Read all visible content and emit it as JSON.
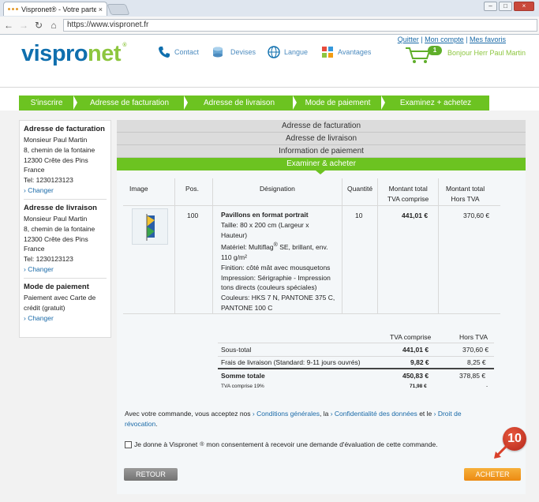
{
  "browser": {
    "tab_title": "Vispronet® - Votre parten",
    "tab_close": "×",
    "url": "https://www.vispronet.fr",
    "window_buttons": [
      "–",
      "□",
      "×"
    ]
  },
  "header": {
    "logo_a": "vispro",
    "logo_b": "net",
    "logo_reg": "®",
    "nav": [
      {
        "label": "Contact",
        "icon": "phone-icon"
      },
      {
        "label": "Devises",
        "icon": "coins-icon"
      },
      {
        "label": "Langue",
        "icon": "globe-icon"
      },
      {
        "label": "Avantages",
        "icon": "puzzle-icon"
      }
    ],
    "top_links": [
      "Quitter",
      "Mon compte",
      "Mes favoris"
    ],
    "cart_count": "1",
    "greeting": "Bonjour Herr Paul Martin"
  },
  "steps": [
    "S'inscrire",
    "Adresse de facturation",
    "Adresse de livraison",
    "Mode de paiement",
    "Examinez + achetez"
  ],
  "sidebar": {
    "billing": {
      "title": "Adresse de facturation",
      "lines": [
        "Monsieur Paul Martin",
        "8, chemin de la fontaine",
        "12300 Crête des Pins",
        "France",
        "Tel: 1230123123"
      ],
      "change": "› Changer"
    },
    "shipping": {
      "title": "Adresse de livraison",
      "lines": [
        "Monsieur Paul Martin",
        "8, chemin de la fontaine",
        "12300 Crête des Pins",
        "France",
        "Tel: 1230123123"
      ],
      "change": "› Changer"
    },
    "payment": {
      "title": "Mode de paiement",
      "lines": [
        "Paiement avec Carte de",
        "crédit (gratuit)"
      ],
      "change": "› Changer"
    }
  },
  "accordion": [
    "Adresse de facturation",
    "Adresse de livraison",
    "Information de paiement",
    "Examiner & acheter"
  ],
  "table": {
    "headers": {
      "image": "Image",
      "pos": "Pos.",
      "designation": "Désignation",
      "quantity": "Quantité",
      "total_ttc_1": "Montant total",
      "total_ttc_2": "TVA comprise",
      "total_ht_1": "Montant total",
      "total_ht_2": "Hors TVA"
    },
    "row": {
      "pos": "100",
      "title": "Pavillons en format portrait",
      "lines": [
        "Taille: 80 x 200 cm (Largeur x",
        "Hauteur)",
        "Matériel: Multiflag",
        "110 g/m²",
        "Finition: côté mât avec mousquetons",
        "Impression: Sérigraphie - Impression",
        "tons directs (couleurs spéciales)",
        "Couleurs: HKS 7 N, PANTONE 375 C,",
        "PANTONE 100 C"
      ],
      "material_rest": "SE, brillant, env.",
      "reg": "®",
      "quantity": "10",
      "total_ttc": "441,01 €",
      "total_ht": "370,60 €"
    }
  },
  "totals": {
    "header_ttc": "TVA comprise",
    "header_ht": "Hors TVA",
    "rows": [
      {
        "label": "Sous-total",
        "ttc": "441,01 €",
        "ht": "370,60 €"
      },
      {
        "label": "Frais de livraison (Standard: 9-11 jours ouvrés)",
        "ttc": "9,82 €",
        "ht": "8,25 €"
      },
      {
        "label": "Somme totale",
        "ttc": "450,83 €",
        "ht": "378,85 €"
      },
      {
        "label": "TVA comprise 19%",
        "ttc": "71,98 €",
        "ht": "-"
      }
    ]
  },
  "terms": {
    "t1": "Avec votre commande, vous acceptez nos",
    "l1": "› Conditions générales",
    "t2": ", la",
    "l2": "› Confidentialité des données",
    "t3": "et le",
    "l3": "› Droit de révocation",
    "t4": "."
  },
  "consent": {
    "a": "Je donne à Vispronet",
    "reg": "®",
    "b": "mon consentement à recevoir une demande d'évaluation de cette commande."
  },
  "buttons": {
    "back": "RETOUR",
    "buy": "ACHETER"
  },
  "marker": "10",
  "colors": {
    "brand_blue": "#0f6fae",
    "brand_green": "#8dc63f",
    "step_green": "#6cc321",
    "buy_orange": "#ec8a12"
  }
}
